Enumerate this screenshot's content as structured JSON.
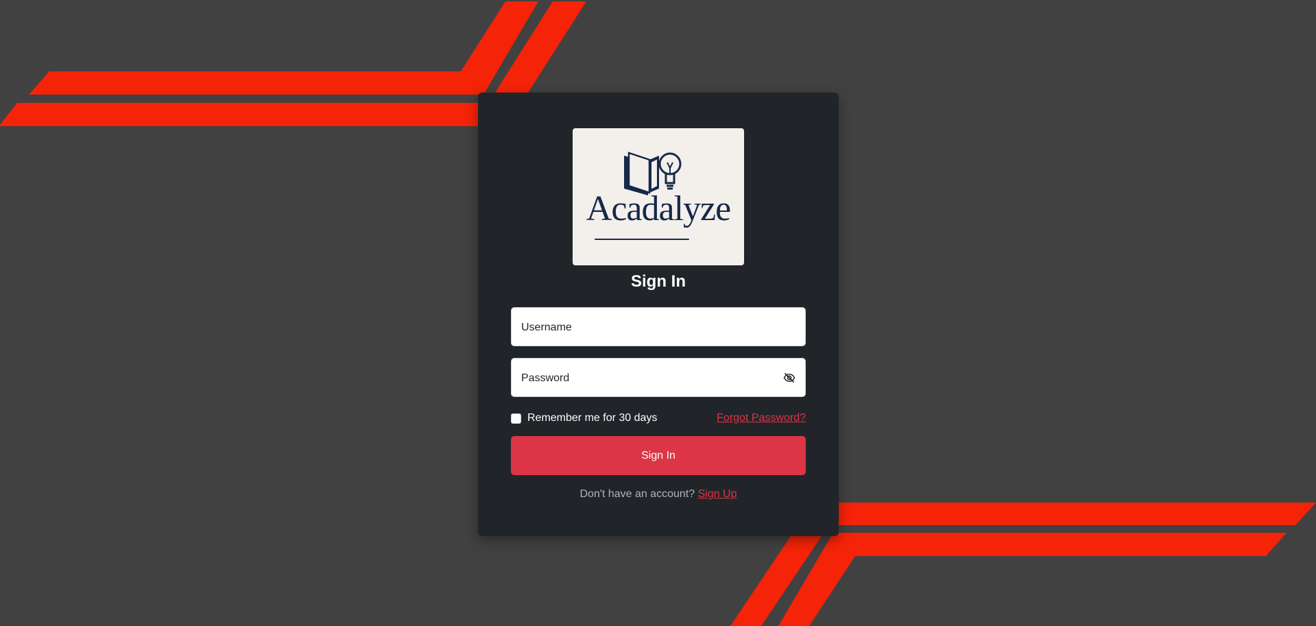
{
  "background": {
    "color": "#414141",
    "stripe_color": "#f52308"
  },
  "logo": {
    "wordmark": "Acadalyze",
    "icon": "book-lightbulb-icon",
    "text_color": "#16294a",
    "background": "#f3efeb"
  },
  "form": {
    "title": "Sign In",
    "username": {
      "placeholder": "Username",
      "value": ""
    },
    "password": {
      "placeholder": "Password",
      "value": "",
      "toggle_icon": "eye-slash-icon"
    },
    "remember_label": "Remember me for 30 days",
    "remember_checked": false,
    "forgot_link": "Forgot Password?",
    "submit_label": "Sign In",
    "signup_prompt": "Don't have an account?",
    "signup_link": "Sign Up"
  },
  "colors": {
    "accent": "#dc3545",
    "card": "#212529"
  }
}
